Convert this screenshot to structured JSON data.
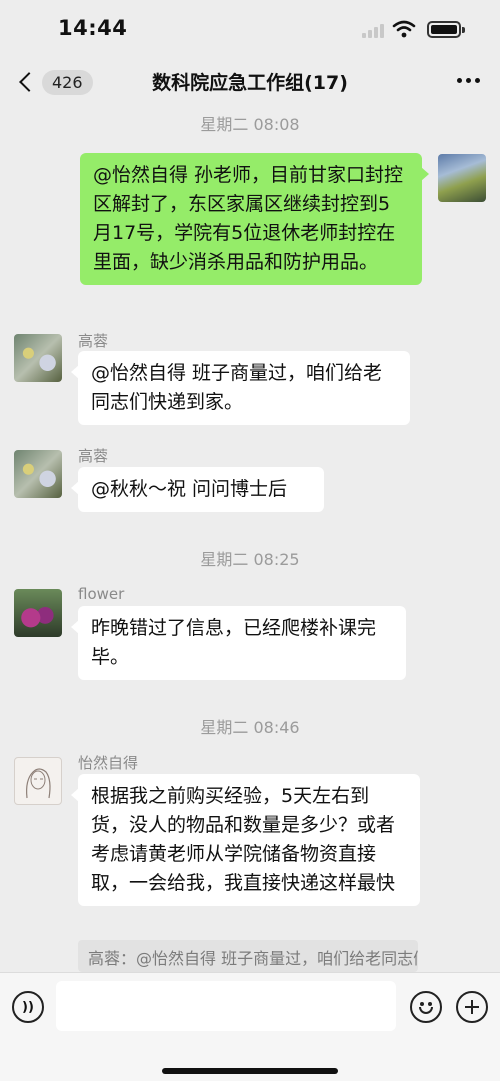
{
  "status_bar": {
    "time": "14:44"
  },
  "nav": {
    "back_count": "426",
    "title": "数科院应急工作组(17)"
  },
  "timestamps": [
    "星期二 08:08",
    "星期二 08:25",
    "星期二 08:46"
  ],
  "messages": [
    {
      "sender": "self",
      "text": "@怡然自得 孙老师，目前甘家口封控区解封了，东区家属区继续封控到5月17号，学院有5位退休老师封控在里面，缺少消杀用品和防护用品。"
    },
    {
      "sender": "高蓉",
      "text": "@怡然自得 班子商量过，咱们给老同志们快递到家。"
    },
    {
      "sender": "高蓉",
      "text": "@秋秋～祝 问问博士后"
    },
    {
      "sender": "flower",
      "text": "昨晚错过了信息，已经爬楼补课完毕。"
    },
    {
      "sender": "怡然自得",
      "text": "根据我之前购买经验，5天左右到货，没人的物品和数量是多少？或者考虑请黄老师从学院储备物资直接取，一会给我，我直接快递这样最快",
      "quote": "高蓉：@怡然自得 班子商量过，咱们给老同志们快递到家。"
    }
  ],
  "input_bar": {
    "voice_label": "))"
  },
  "colors": {
    "self_bubble": "#95ec69",
    "other_bubble": "#ffffff",
    "background": "#ededed"
  },
  "icons": [
    "back-icon",
    "more-icon",
    "voice-icon",
    "emoji-icon",
    "plus-icon",
    "wifi-icon",
    "battery-icon",
    "signal-icon"
  ]
}
